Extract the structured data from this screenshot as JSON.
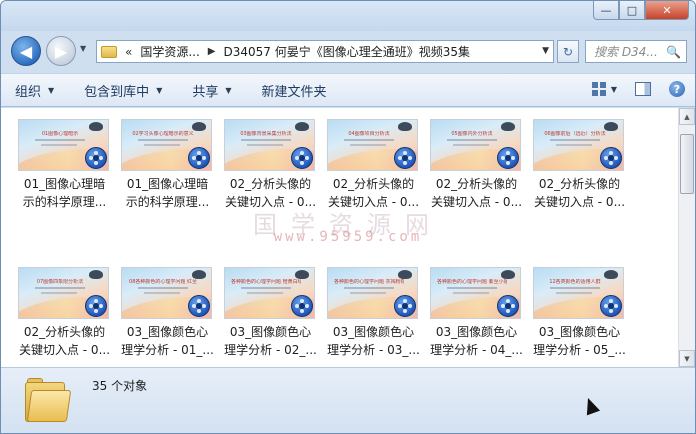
{
  "window": {
    "caption_minimize": "—",
    "caption_maximize": "□",
    "caption_close": "✕"
  },
  "nav": {
    "back_icon": "◀",
    "forward_icon": "▶",
    "history_dropdown": "▼",
    "address_overflow": "«",
    "breadcrumb": [
      "国学资源...",
      "D34057 何晏宁《图像心理全通班》视频35集"
    ],
    "address_dropdown": "▼",
    "refresh_icon": "↻",
    "search_placeholder": "搜索 D34...",
    "search_icon": "🔍"
  },
  "toolbar": {
    "organize": "组织",
    "include_in_library": "包含到库中",
    "share": "共享",
    "new_folder": "新建文件夹",
    "dropdown_arrow": "▼",
    "help": "?"
  },
  "files": [
    {
      "name": "01_图像心理暗\n示的科学原理...",
      "thumb_title": "01图像心理暗示"
    },
    {
      "name": "01_图像心理暗\n示的科学原理...",
      "thumb_title": "02学习头像心理暗示的意义"
    },
    {
      "name": "02_分析头像的\n关键切入点 - 0...",
      "thumb_title": "03图像背景采集分析法"
    },
    {
      "name": "02_分析头像的\n关键切入点 - 0...",
      "thumb_title": "04图像项目分析法"
    },
    {
      "name": "02_分析头像的\n关键切入点 - 0...",
      "thumb_title": "05图像内外分析法"
    },
    {
      "name": "02_分析头像的\n关键切入点 - 0...",
      "thumb_title": "06图像前后（远近）分析法"
    },
    {
      "name": "02_分析头像的\n关键切入点 - 0...",
      "thumb_title": "07图像四象限分析法"
    },
    {
      "name": "03_图像颜色心\n理学分析 - 01_...",
      "thumb_title": "08各种颜色的心理学问题 红至"
    },
    {
      "name": "03_图像颜色心\n理学分析 - 02_...",
      "thumb_title": "各种颜色的心理学问题 橙黄白绿"
    },
    {
      "name": "03_图像颜色心\n理学分析 - 03_...",
      "thumb_title": "各种颜色的心理学问题 灰褐粉棕"
    },
    {
      "name": "03_图像颜色心\n理学分析 - 04_...",
      "thumb_title": "各种颜色的心理学问题 紫至小姐妹"
    },
    {
      "name": "03_图像颜色心\n理学分析 - 05_...",
      "thumb_title": "12各类颜色的适用人群"
    }
  ],
  "watermark": {
    "text": "国学资源网",
    "url": "www.95959.com"
  },
  "status": {
    "count_text": "35 个对象"
  }
}
